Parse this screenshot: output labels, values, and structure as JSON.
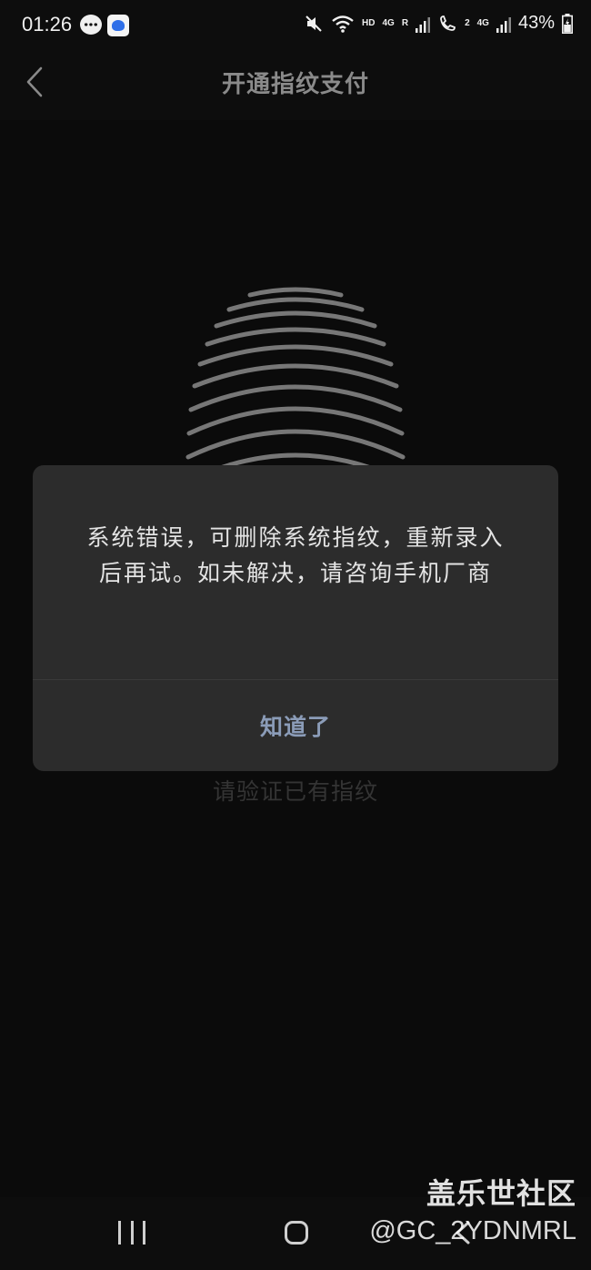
{
  "status_bar": {
    "time": "01:26",
    "hd_label": "HD",
    "net1_label": "4G",
    "roaming_label": "R",
    "sim2_label": "2",
    "net2_label": "4G",
    "battery_percent": "43%"
  },
  "header": {
    "title": "开通指纹支付"
  },
  "main": {
    "hint": "请验证已有指纹"
  },
  "dialog": {
    "message": "系统错误，可删除系统指纹，重新录入后再试。如未解决，请咨询手机厂商",
    "confirm_label": "知道了"
  },
  "watermark": {
    "site": "盖乐世社区",
    "user": "@GC_2YDNMRL"
  },
  "colors": {
    "background": "#0d0d0d",
    "dialog_bg": "#2c2c2c",
    "confirm_text": "#8b9cb8",
    "fingerprint": "#8c8c8c"
  }
}
